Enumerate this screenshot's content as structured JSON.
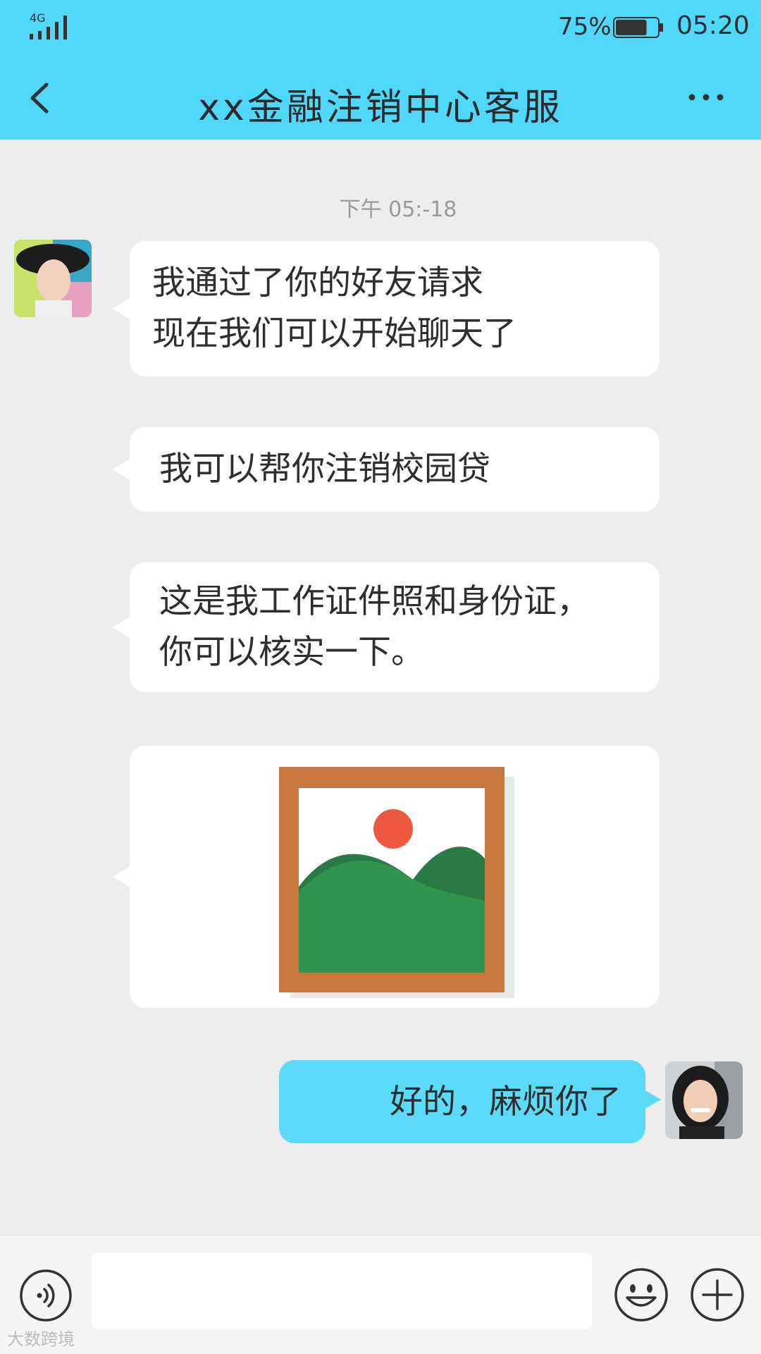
{
  "status_bar": {
    "network": "4G",
    "battery_percent": "75%",
    "battery_level": 0.75,
    "time": "05:20"
  },
  "header": {
    "title": "xx金融注销中心客服",
    "back_icon": "chevron-left-icon",
    "more_icon": "more-dots-icon"
  },
  "chat": {
    "timestamp": "下午 05:-18",
    "messages": [
      {
        "side": "left",
        "lines": [
          "我通过了你的好友请求",
          "现在我们可以开始聊天了"
        ]
      },
      {
        "side": "left",
        "lines": [
          "我可以帮你注销校园贷"
        ]
      },
      {
        "side": "left",
        "lines": [
          "这是我工作证件照和身份证，",
          "你可以核实一下。"
        ]
      },
      {
        "side": "left",
        "type": "image",
        "icon": "image-placeholder-icon"
      },
      {
        "side": "right",
        "lines": [
          "好的，麻烦你了"
        ]
      }
    ]
  },
  "input_bar": {
    "placeholder": "",
    "voice_icon": "voice-icon",
    "emoji_icon": "emoji-icon",
    "plus_icon": "plus-icon"
  },
  "watermark": "大数跨境",
  "colors": {
    "header": "#4fd8fc",
    "background": "#ededed",
    "sent_bubble": "#5bdaf9",
    "received_bubble": "#ffffff"
  }
}
